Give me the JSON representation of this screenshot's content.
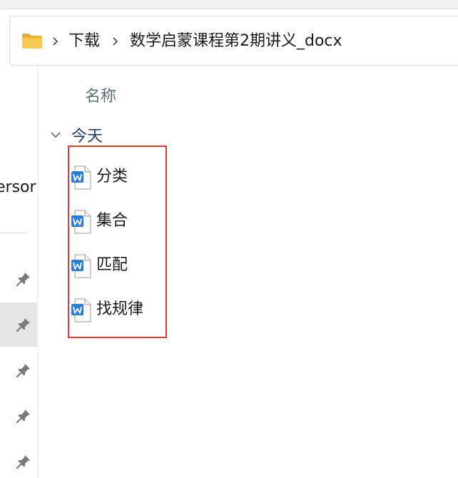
{
  "address_bar": {
    "folder_icon": "folder-icon",
    "breadcrumbs": [
      "下载",
      "数学启蒙课程第2期讲义_docx"
    ]
  },
  "nav_pane": {
    "partial_item_label": "ersor",
    "pinned_items": [
      {
        "icon": "pin-icon",
        "selected": false
      },
      {
        "icon": "pin-icon",
        "selected": true
      },
      {
        "icon": "pin-icon",
        "selected": false
      },
      {
        "icon": "pin-icon",
        "selected": false
      },
      {
        "icon": "pin-icon",
        "selected": false
      }
    ]
  },
  "file_view": {
    "column_header": "名称",
    "group": {
      "label": "今天",
      "expanded": true,
      "files": [
        {
          "name": "分类",
          "icon": "word-doc-icon"
        },
        {
          "name": "集合",
          "icon": "word-doc-icon"
        },
        {
          "name": "匹配",
          "icon": "word-doc-icon"
        },
        {
          "name": "找规律",
          "icon": "word-doc-icon"
        }
      ]
    }
  },
  "colors": {
    "highlight_border": "#e53935",
    "group_label": "#1b3a6b",
    "column_header": "#5c6f80",
    "word_blue": "#2b7cd3",
    "folder_yellow": "#f3c244"
  }
}
